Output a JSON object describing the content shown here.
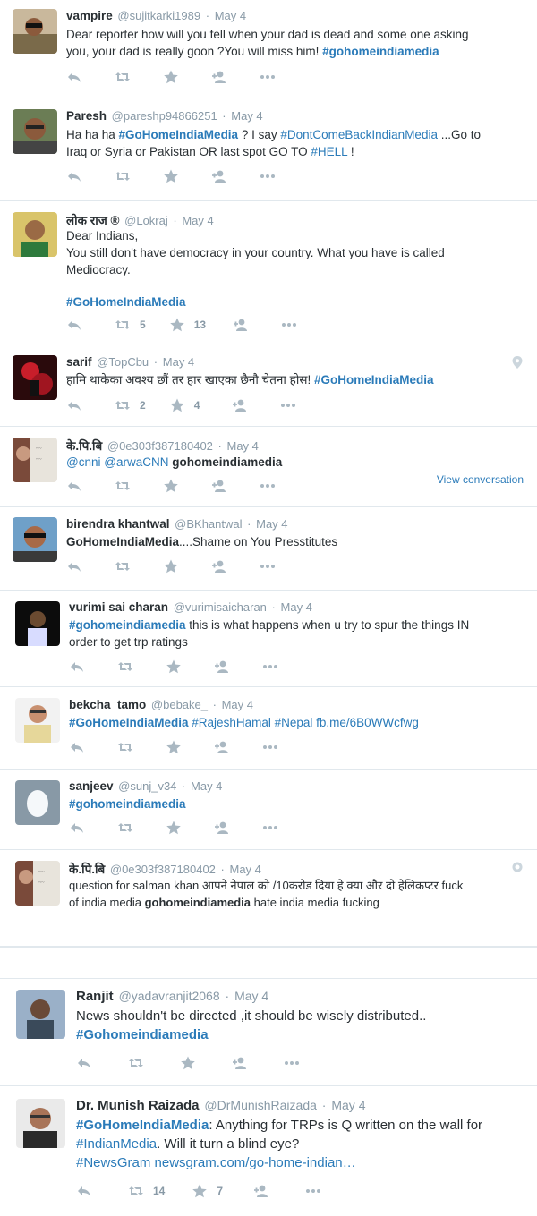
{
  "tweets": [
    {
      "name": "vampire",
      "handle": "@sujitkarki1989",
      "time": "May 4",
      "line1": "Dear reporter how will you fell when your dad is dead and some one asking",
      "line2a": "you, your dad is really goon ?You will miss him! ",
      "line2b": "#gohomeindiamedia"
    },
    {
      "name": "Paresh",
      "handle": "@pareshp94866251",
      "time": "May 4",
      "a": "Ha ha ha ",
      "b": "#GoHomeIndiaMedia",
      "c": " ? I say ",
      "d": "#DontComeBackIndianMedia",
      "e": " ...Go to",
      "f": "Iraq or Syria or Pakistan OR last spot GO TO ",
      "g": "#HELL",
      "h": " !"
    },
    {
      "name": "लोक राज ®",
      "handle": "@Lokraj",
      "time": "May 4",
      "l1": "Dear Indians,",
      "l2": "You still don't have democracy in your country. What you have is called",
      "l3": "Mediocracy.",
      "tag": "#GoHomeIndiaMedia",
      "retweets": "5",
      "favorites": "13"
    },
    {
      "name": "sarif",
      "handle": "@TopCbu",
      "time": "May 4",
      "a": "हामि थाकेका अवश्य छौं तर हार खाएका छैनौ चेतना होस! ",
      "b": "#GoHomeIndiaMedia",
      "retweets": "2",
      "favorites": "4"
    },
    {
      "name": "के.पि.बि",
      "handle": "@0e303f387180402",
      "time": "May 4",
      "a": "@cnni",
      "b": "@arwaCNN",
      "c": "gohomeindiamedia",
      "view": "View conversation"
    },
    {
      "name": "birendra khantwal",
      "handle": "@BKhantwal",
      "time": "May 4",
      "a": "GoHomeIndiaMedia",
      "b": "....Shame on You Presstitutes"
    },
    {
      "name": "vurimi sai charan",
      "handle": "@vurimisaicharan",
      "time": "May 4",
      "a": "#gohomeindiamedia",
      "b": " this is what happens when u try to spur the things IN",
      "c": "order to get trp ratings"
    },
    {
      "name": "bekcha_tamo",
      "handle": "@bebake_",
      "time": "May 4",
      "a": "#GoHomeIndiaMedia",
      "b": "#RajeshHamal",
      "c": "#Nepal",
      "d": "fb.me/6B0WWcfwg"
    },
    {
      "name": "sanjeev",
      "handle": "@sunj_v34",
      "time": "May 4",
      "a": "#gohomeindiamedia"
    },
    {
      "name": "के.पि.बि",
      "handle": "@0e303f387180402",
      "time": "May 4",
      "a": "question for salman khan आपने नेपाल को /10करोड दिया हे क्या और दो हेलिकप्टर fuck",
      "b": "of india media ",
      "c": "gohomeindiamedia",
      "d": " hate india media fucking"
    },
    {
      "name": "Ranjit",
      "handle": "@yadavranjit2068",
      "time": "May 4",
      "a": "News shouldn't be directed ,it should be wisely distributed..",
      "b": "#Gohomeindiamedia"
    },
    {
      "name": "Dr. Munish Raizada",
      "handle": "@DrMunishRaizada",
      "time": "May 4",
      "a": "#GoHomeIndiaMedia",
      "b": ": Anything for TRPs is Q written on the wall for",
      "c": "#IndianMedia",
      "d": ". Will it turn a blind eye?",
      "e": "#NewsGram",
      "f": "newsgram.com/go-home-indian…",
      "retweets": "14",
      "favorites": "7"
    }
  ],
  "icons": {
    "reply": "reply-icon",
    "retweet": "retweet-icon",
    "favorite": "star-icon",
    "follow": "follow-icon",
    "more": "more-icon"
  },
  "colors": {
    "link": "#2b7bb9",
    "muted": "#8899a6",
    "icon": "#aab8c2"
  }
}
